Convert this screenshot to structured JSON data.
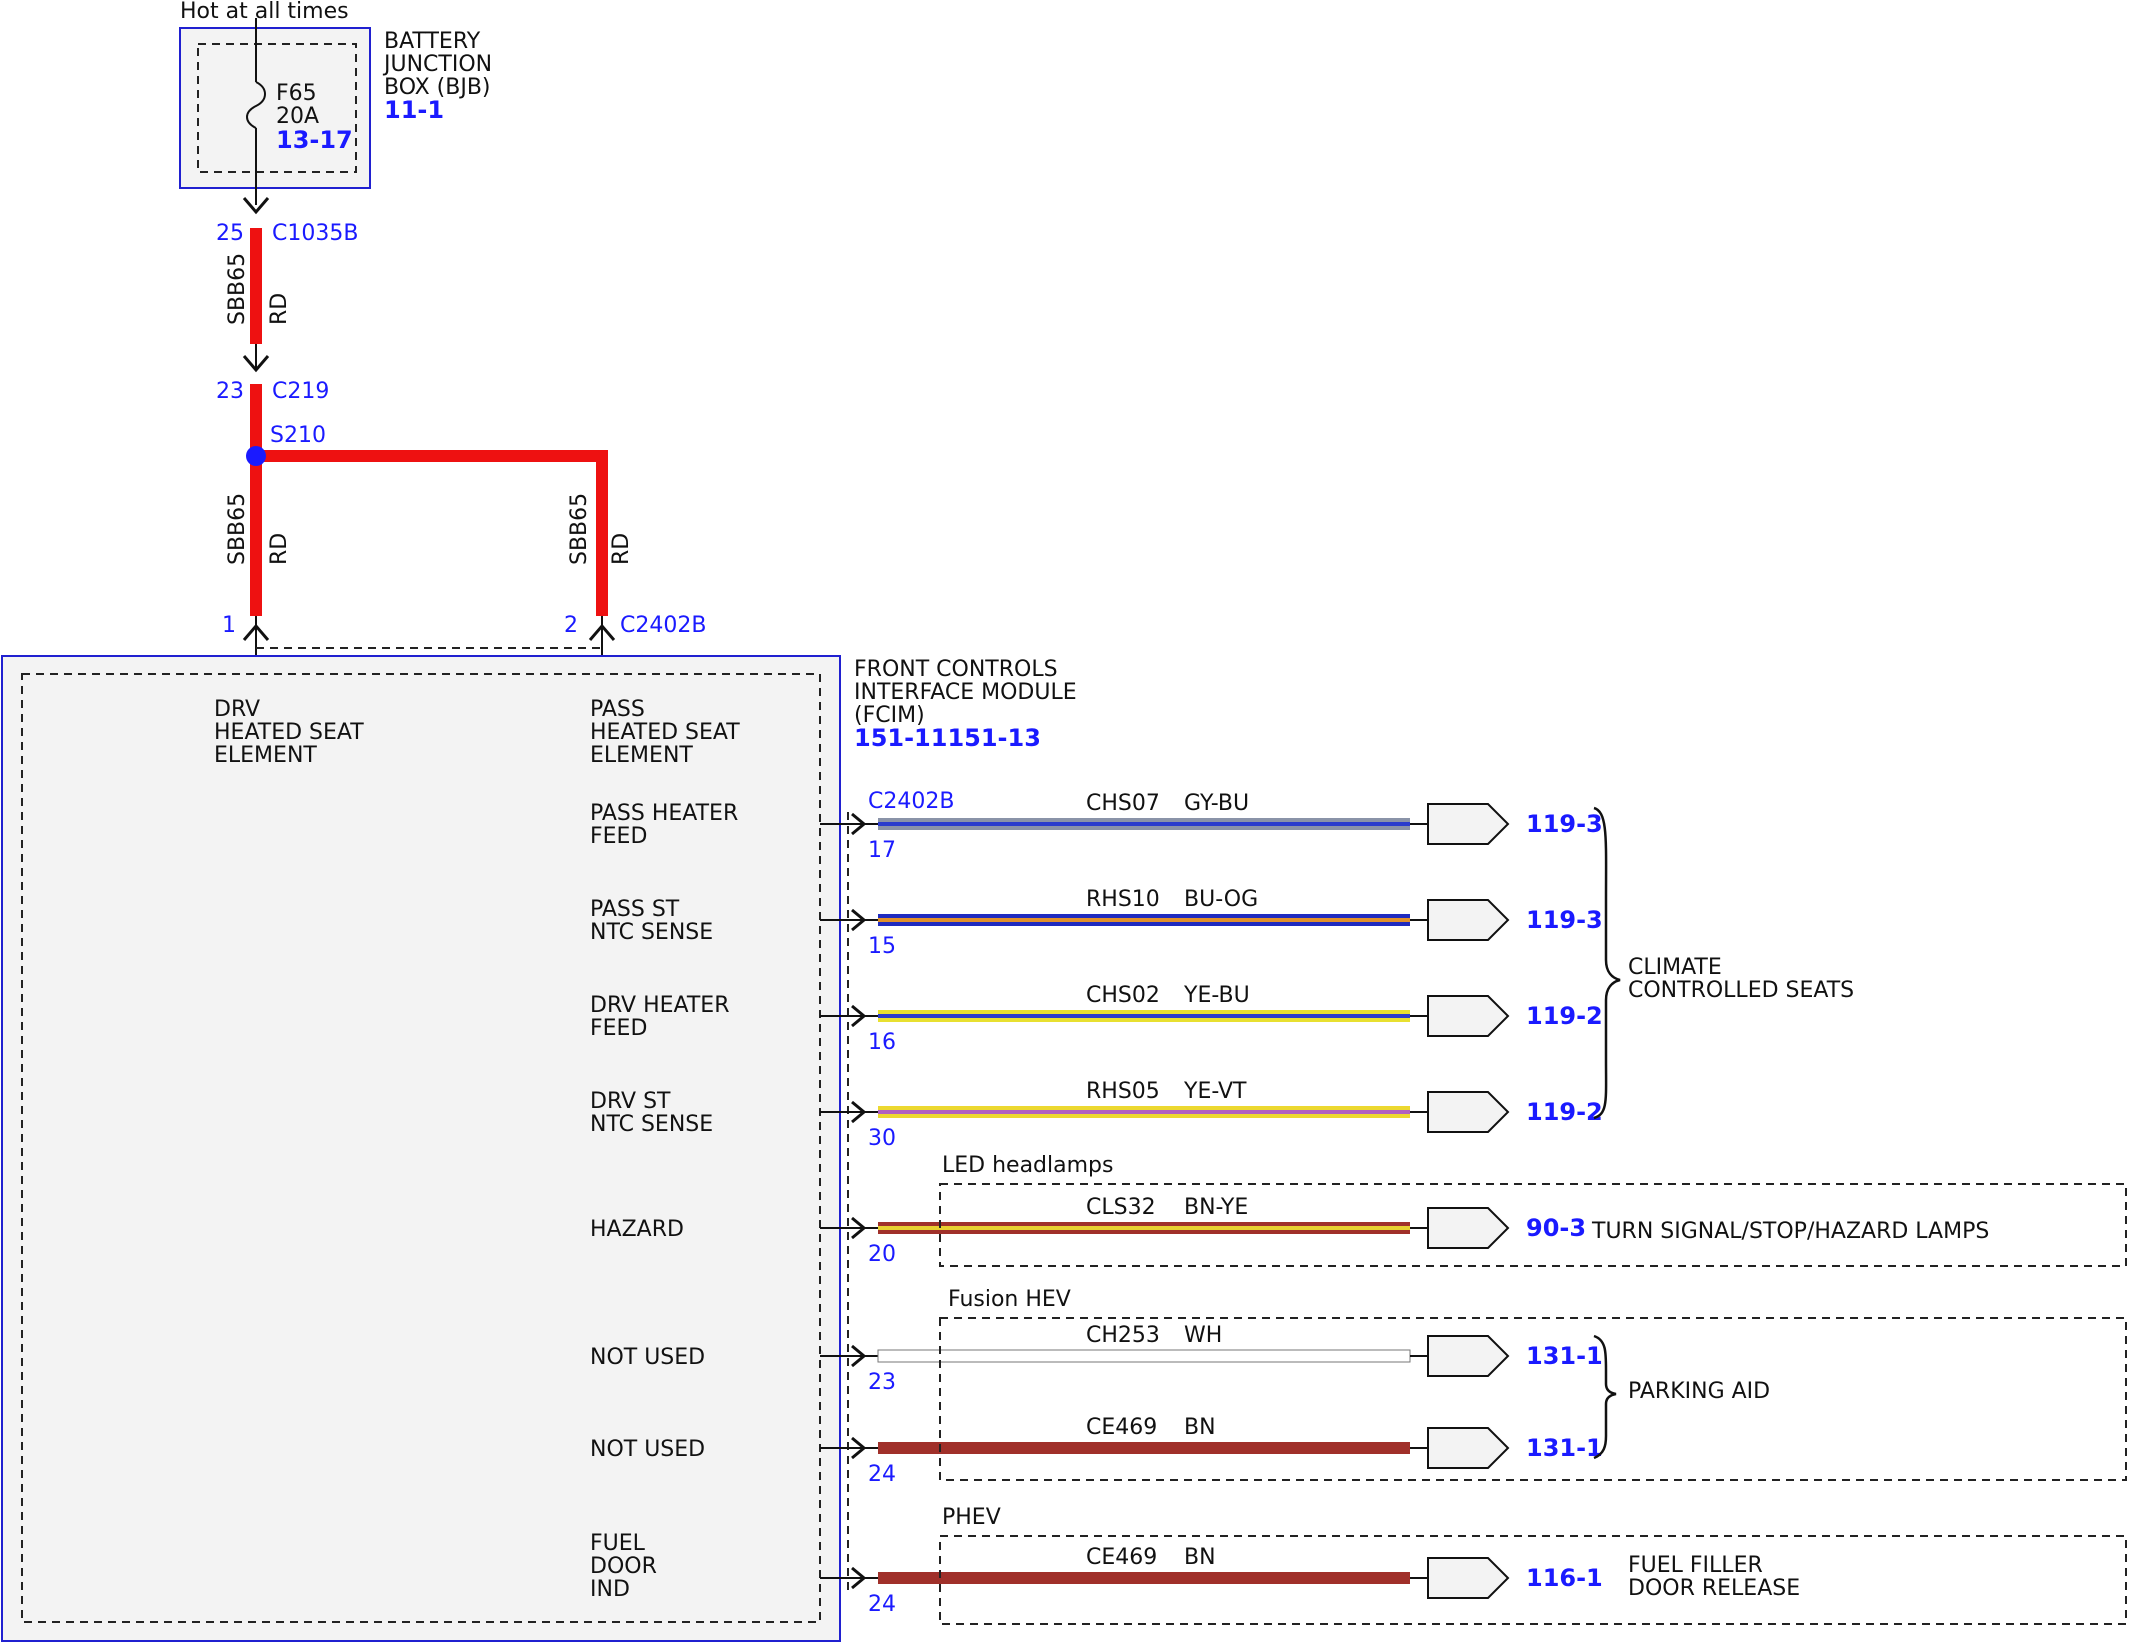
{
  "supply": {
    "hot_label": "Hot at all times",
    "bjb_name_1": "BATTERY",
    "bjb_name_2": "JUNCTION",
    "bjb_name_3": "BOX (BJB)",
    "bjb_ref": "11-1",
    "fuse_id": "F65",
    "fuse_rating": "20A",
    "fuse_ref": "13-17"
  },
  "connectors": {
    "c1035b_pin": "25",
    "c1035b_name": "C1035B",
    "c219_pin": "23",
    "c219_name": "C219",
    "splice": "S210",
    "c2402b_pin1": "1",
    "c2402b_pin2": "2",
    "c2402b_name": "C2402B"
  },
  "feed_wires": {
    "upper_circuit": "SBB65",
    "upper_color": "RD",
    "left_circuit": "SBB65",
    "left_color": "RD",
    "right_circuit": "SBB65",
    "right_color": "RD"
  },
  "module": {
    "name_1": "FRONT CONTROLS",
    "name_2": "INTERFACE MODULE",
    "name_3": "(FCIM)",
    "ref": "151-11151-13",
    "drv_1": "DRV",
    "drv_2": "HEATED SEAT",
    "drv_3": "ELEMENT",
    "pass_1": "PASS",
    "pass_2": "HEATED SEAT",
    "pass_3": "ELEMENT",
    "connector": "C2402B"
  },
  "outputs": [
    {
      "label_1": "PASS HEATER",
      "label_2": "FEED",
      "label_3": "",
      "pin": "17",
      "circuit": "CHS07",
      "color_code": "GY-BU",
      "ref": "119-3",
      "base_color": "#8a93a8",
      "stripe_color": "#2a3ccc"
    },
    {
      "label_1": "PASS ST",
      "label_2": "NTC SENSE",
      "label_3": "",
      "pin": "15",
      "circuit": "RHS10",
      "color_code": "BU-OG",
      "ref": "119-3",
      "base_color": "#1f2bbf",
      "stripe_color": "#e0902a"
    },
    {
      "label_1": "DRV HEATER",
      "label_2": "FEED",
      "label_3": "",
      "pin": "16",
      "circuit": "CHS02",
      "color_code": "YE-BU",
      "ref": "119-2",
      "base_color": "#e8e030",
      "stripe_color": "#2a3ccc"
    },
    {
      "label_1": "DRV ST",
      "label_2": "NTC SENSE",
      "label_3": "",
      "pin": "30",
      "circuit": "RHS05",
      "color_code": "YE-VT",
      "ref": "119-2",
      "base_color": "#ecd830",
      "stripe_color": "#b060c0"
    },
    {
      "label_1": "HAZARD",
      "label_2": "",
      "label_3": "",
      "pin": "20",
      "circuit": "CLS32",
      "color_code": "BN-YE",
      "ref": "90-3",
      "base_color": "#a0302a",
      "stripe_color": "#e8d030"
    },
    {
      "label_1": "NOT USED",
      "label_2": "",
      "label_3": "",
      "pin": "23",
      "circuit": "CH253",
      "color_code": "WH",
      "ref": "131-1",
      "base_color": "#ffffff",
      "stripe_color": "#ffffff"
    },
    {
      "label_1": "NOT USED",
      "label_2": "",
      "label_3": "",
      "pin": "24",
      "circuit": "CE469",
      "color_code": "BN",
      "ref": "131-1",
      "base_color": "#a0302a",
      "stripe_color": "#a0302a"
    },
    {
      "label_1": "FUEL",
      "label_2": "DOOR",
      "label_3": "IND",
      "pin": "24",
      "circuit": "CE469",
      "color_code": "BN",
      "ref": "116-1",
      "base_color": "#a0302a",
      "stripe_color": "#a0302a"
    }
  ],
  "groups": {
    "climate": "CLIMATE",
    "climate_2": "CONTROLLED SEATS",
    "led_option": "LED headlamps",
    "turn_signal": "TURN SIGNAL/STOP/HAZARD LAMPS",
    "hev_option": "Fusion HEV",
    "parking": "PARKING AID",
    "phev_option": "PHEV",
    "fuel_1": "FUEL FILLER",
    "fuel_2": "DOOR RELEASE"
  },
  "colors": {
    "wire_red": "#ee1111",
    "blue_ref": "#1a1aff",
    "box_fill": "#f3f3f3",
    "box_border": "#2020d0"
  }
}
